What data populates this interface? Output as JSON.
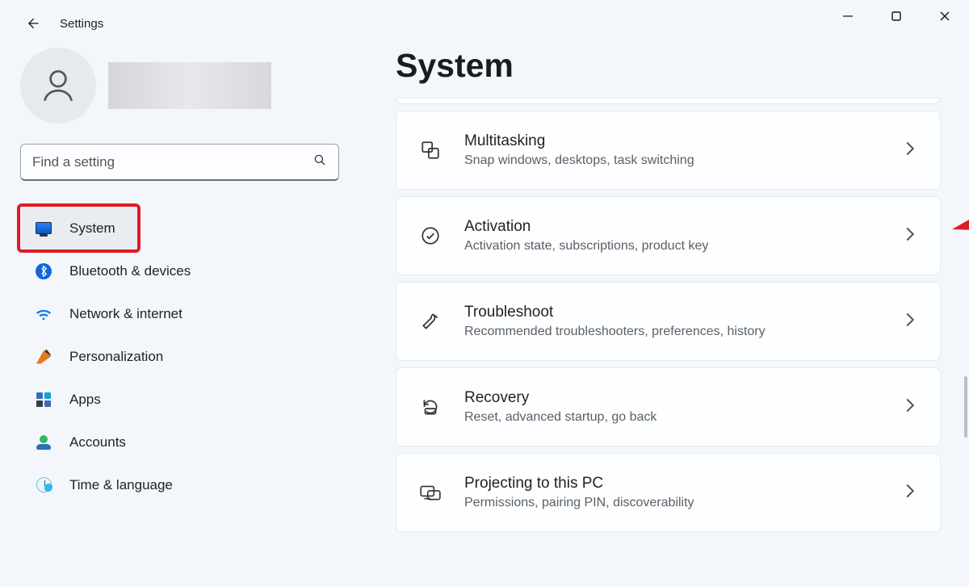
{
  "window": {
    "title": "Settings"
  },
  "search": {
    "placeholder": "Find a setting"
  },
  "sidebar": {
    "items": [
      {
        "label": "System"
      },
      {
        "label": "Bluetooth & devices"
      },
      {
        "label": "Network & internet"
      },
      {
        "label": "Personalization"
      },
      {
        "label": "Apps"
      },
      {
        "label": "Accounts"
      },
      {
        "label": "Time & language"
      }
    ]
  },
  "main": {
    "title": "System",
    "cards": [
      {
        "title": "Multitasking",
        "sub": "Snap windows, desktops, task switching"
      },
      {
        "title": "Activation",
        "sub": "Activation state, subscriptions, product key"
      },
      {
        "title": "Troubleshoot",
        "sub": "Recommended troubleshooters, preferences, history"
      },
      {
        "title": "Recovery",
        "sub": "Reset, advanced startup, go back"
      },
      {
        "title": "Projecting to this PC",
        "sub": "Permissions, pairing PIN, discoverability"
      }
    ]
  },
  "annotation": {
    "arrow_color": "#e01b24",
    "highlight_color": "#e01b24"
  }
}
